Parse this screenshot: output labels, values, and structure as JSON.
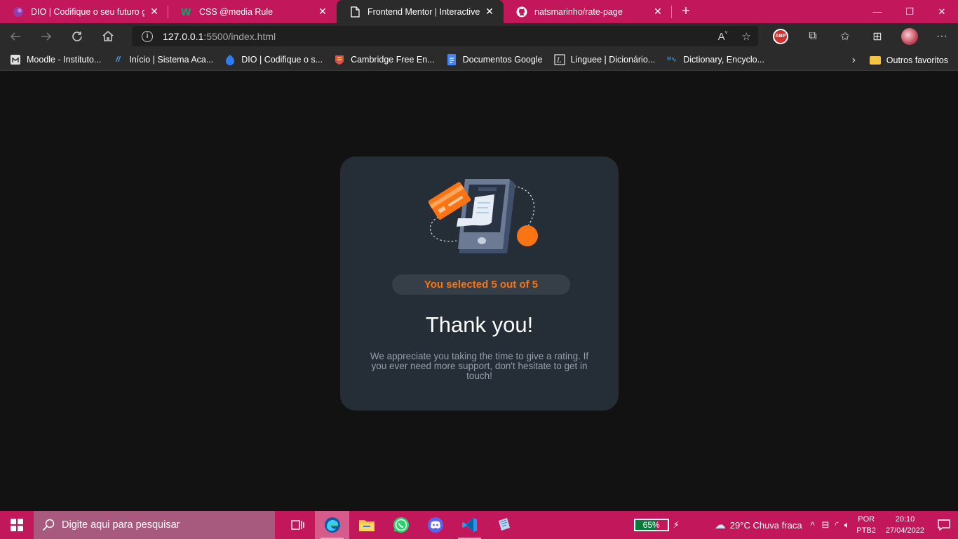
{
  "browser": {
    "tabs": [
      {
        "title": "DIO | Codifique o seu futuro global",
        "icon": "dio-icon",
        "active": false
      },
      {
        "title": "CSS @media Rule",
        "icon": "w3schools-icon",
        "active": false
      },
      {
        "title": "Frontend Mentor | Interactive rating component",
        "icon": "page-icon",
        "active": true
      },
      {
        "title": "natsmarinho/rate-page",
        "icon": "github-icon",
        "active": false
      }
    ],
    "new_tab": "+",
    "address": {
      "host": "127.0.0.1",
      "path": ":5500/index.html"
    },
    "bookmarks": [
      {
        "label": "Moodle - Instituto...",
        "icon": "moodle-icon"
      },
      {
        "label": "Início | Sistema Aca...",
        "icon": "slashes-icon"
      },
      {
        "label": "DIO | Codifique o s...",
        "icon": "dio-icon"
      },
      {
        "label": "Cambridge Free En...",
        "icon": "cambridge-icon"
      },
      {
        "label": "Documentos Google",
        "icon": "google-docs-icon"
      },
      {
        "label": "Linguee | Dicionário...",
        "icon": "linguee-icon"
      },
      {
        "label": "Dictionary, Encyclo...",
        "icon": "dictionary-icon"
      }
    ],
    "other_favorites": "Outros favoritos",
    "abp_label": "ABP"
  },
  "card": {
    "selected_text": "You selected 5 out of 5",
    "title": "Thank you!",
    "message": "We appreciate you taking the time to give a rating. If you ever need more support, don't hesitate to get in touch!",
    "accent_color": "#fb7413",
    "background_color": "#252d37"
  },
  "taskbar": {
    "search_placeholder": "Digite aqui para pesquisar",
    "battery": {
      "label": "65%",
      "level": 0.65
    },
    "weather": "29°C  Chuva fraca",
    "language": {
      "line1": "POR",
      "line2": "PTB2"
    },
    "clock": {
      "time": "20:10",
      "date": "27/04/2022"
    }
  }
}
